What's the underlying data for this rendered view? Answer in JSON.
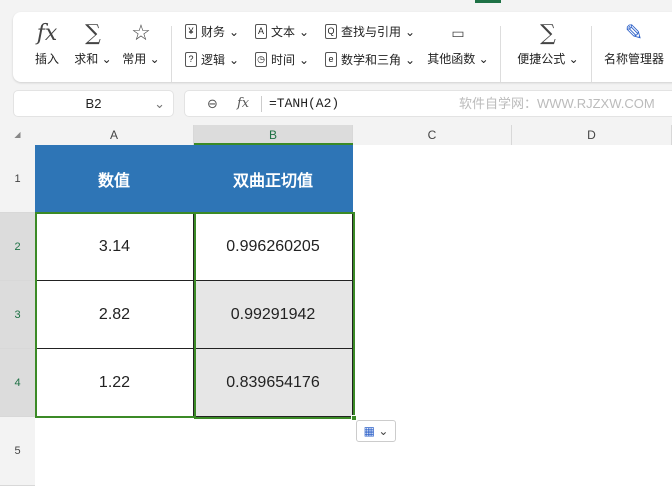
{
  "ribbon": {
    "insert": "插入",
    "sum": "求和",
    "common": "常用",
    "finance": "财务",
    "text": "文本",
    "lookup": "查找与引用",
    "logic": "逻辑",
    "time": "时间",
    "math": "数学和三角",
    "other": "其他函数",
    "quick": "便捷公式",
    "name_manager": "名称管理器"
  },
  "namebox": "B2",
  "formula": "=TANH(A2)",
  "watermark": "软件自学网：WWW.RJZXW.COM",
  "columns": [
    "A",
    "B",
    "C",
    "D"
  ],
  "rows": [
    "1",
    "2",
    "3",
    "4",
    "5"
  ],
  "table": {
    "headers": [
      "数值",
      "双曲正切值"
    ],
    "rows": [
      [
        "3.14",
        "0.996260205"
      ],
      [
        "2.82",
        "0.99291942"
      ],
      [
        "1.22",
        "0.839654176"
      ]
    ]
  }
}
